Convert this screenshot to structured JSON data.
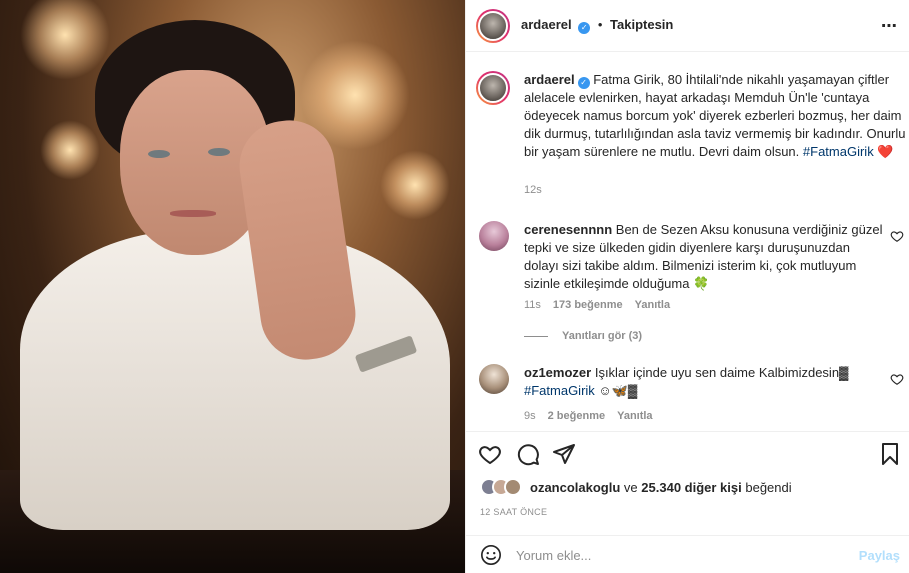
{
  "photo": {
    "alt": "Portrait photo"
  },
  "header": {
    "username": "ardaerel",
    "separator": "•",
    "follow_label": "Takiptesin",
    "more_icon": "⋯"
  },
  "caption": {
    "username": "ardaerel",
    "text": "Fatma Girik, 80 İhtilali'nde nikahlı yaşamayan çiftler alelacele evlenirken, hayat arkadaşı Memduh Ün'le 'cuntaya ödeyecek namus borcum yok' diyerek ezberleri bozmuş, her daim dik durmuş, tutarlılığından asla taviz vermemiş bir kadındır. Onurlu bir yaşam sürenlere ne mutlu. Devri daim olsun.",
    "hashtag": "#FatmaGirik",
    "emoji": "❤️",
    "time": "12s"
  },
  "comments": [
    {
      "username": "cerenesennnn",
      "text": "Ben de Sezen Aksu konusuna verdiğiniz güzel tepki ve size ülkeden gidin diyenlere karşı duruşunuzdan dolayı sizi takibe aldım. Bilmenizi isterim ki, çok mutluyum sizinle etkileşimde olduğuma 🍀",
      "time": "11s",
      "likes": "173 beğenme",
      "reply": "Yanıtla",
      "view_replies": "Yanıtları gör (3)",
      "avatar_color": "#c7a3b8"
    },
    {
      "username": "oz1emozer",
      "text": "Işıklar içinde uyu sen daime Kalbimizdesin▓",
      "hashtag": "#FatmaGirik",
      "suffix": " ☺🦋▓",
      "time": "9s",
      "likes": "2 beğenme",
      "reply": "Yanıtla",
      "avatar_color": "#8d7a6a"
    }
  ],
  "likes": {
    "liker": "ozancolakoglu",
    "connector": "ve",
    "others": "25.340 diğer kişi",
    "suffix": "beğendi"
  },
  "post_age": "12 SAAT ÖNCE",
  "add_comment": {
    "placeholder": "Yorum ekle...",
    "share_label": "Paylaş"
  }
}
